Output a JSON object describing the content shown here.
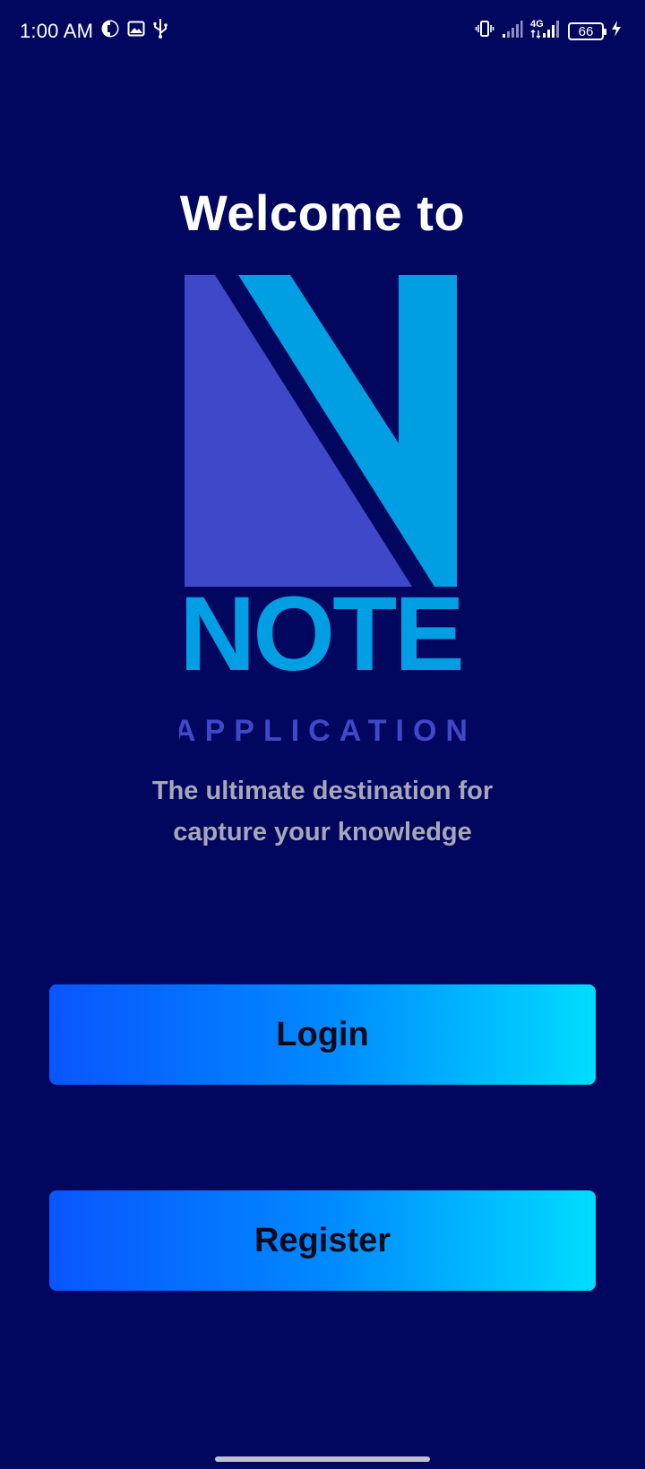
{
  "status_bar": {
    "time": "1:00 AM",
    "network": "4G",
    "battery": "66",
    "icons": [
      "data-saver-icon",
      "gallery-icon",
      "usb-icon",
      "vibrate-icon",
      "signal-icon",
      "signal-4g-icon",
      "battery-icon",
      "charging-icon"
    ]
  },
  "welcome": {
    "title": "Welcome to"
  },
  "logo": {
    "word": "NOTE",
    "subword": "APPLICATION",
    "colors": {
      "primary": "#009fe3",
      "secondary": "#3f48c8"
    }
  },
  "tagline": {
    "line1": "The ultimate destination for",
    "line2": "capture your knowledge"
  },
  "actions": {
    "login_label": "Login",
    "register_label": "Register"
  },
  "theme": {
    "background": "#01075e",
    "button_gradient": [
      "#0a55ff",
      "#00dcff"
    ]
  }
}
